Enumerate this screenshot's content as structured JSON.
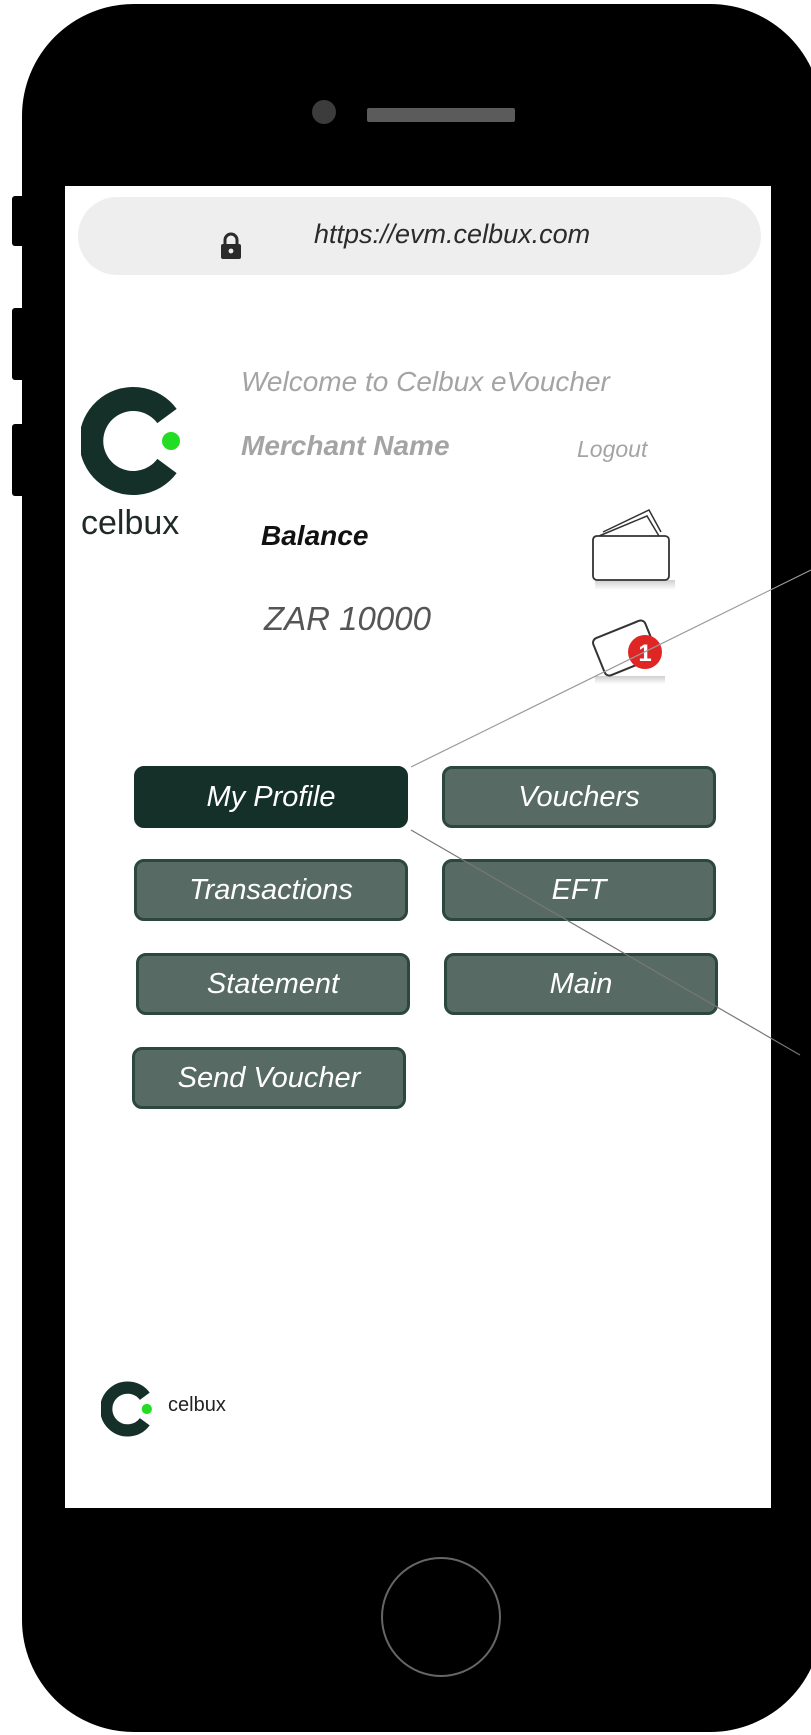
{
  "browser": {
    "url": "https://evm.celbux.com"
  },
  "brand": {
    "logo_word": "celbux",
    "accent_color": "#22dd22",
    "dark_color": "#143029"
  },
  "header": {
    "welcome": "Welcome to Celbux eVoucher",
    "merchant_name": "Merchant Name",
    "logout": "Logout"
  },
  "balance": {
    "label": "Balance",
    "value": "ZAR 10000"
  },
  "notifications": {
    "count": "1"
  },
  "menu": {
    "my_profile": "My Profile",
    "vouchers": "Vouchers",
    "transactions": "Transactions",
    "eft": "EFT",
    "statement": "Statement",
    "main": "Main",
    "send_voucher": "Send Voucher"
  },
  "footer": {
    "logo_word": "celbux"
  },
  "icons": [
    "lock-icon",
    "wallet-icon",
    "notification-icon",
    "celbux-logo"
  ]
}
